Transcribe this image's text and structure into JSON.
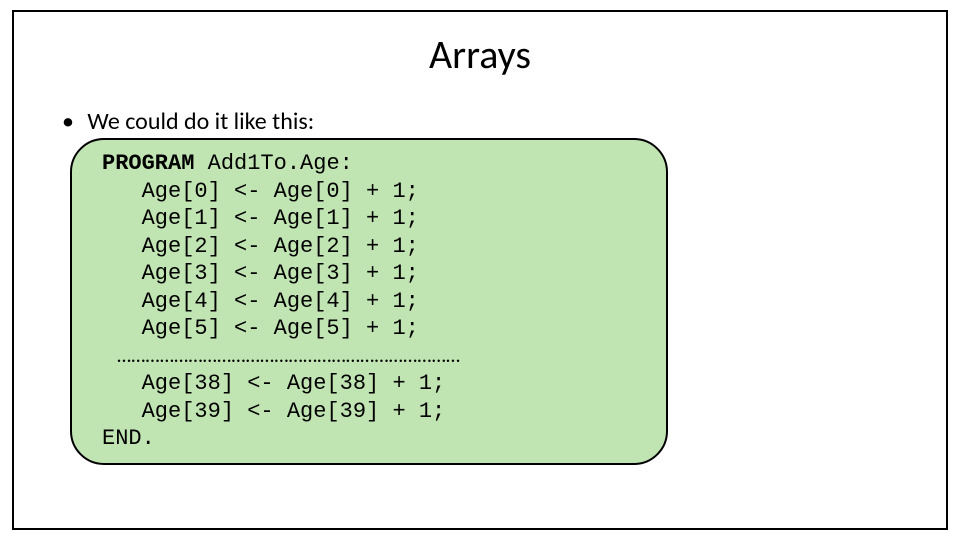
{
  "title": "Arrays",
  "bullet": "We could do it like this:",
  "code": {
    "program_kw": "PROGRAM",
    "program_name": " Add1To.Age:",
    "lines": [
      "   Age[0] <- Age[0] + 1;",
      "   Age[1] <- Age[1] + 1;",
      "   Age[2] <- Age[2] + 1;",
      "   Age[3] <- Age[3] + 1;",
      "   Age[4] <- Age[4] + 1;",
      "   Age[5] <- Age[5] + 1;"
    ],
    "ellipsis": "   ………………………………………………………………",
    "lines2": [
      "   Age[38] <- Age[38] + 1;",
      "   Age[39] <- Age[39] + 1;"
    ],
    "end": "END."
  }
}
